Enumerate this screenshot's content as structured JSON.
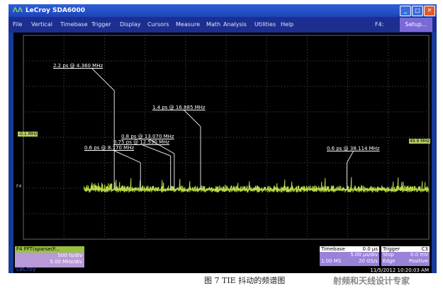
{
  "window": {
    "title": "LeCroy SDA6000",
    "logo": "lecroy-logo-icon",
    "controls": [
      "minimize",
      "maximize",
      "close"
    ]
  },
  "menu": {
    "items": [
      "File",
      "Vertical",
      "Timebase",
      "Trigger",
      "Display",
      "Cursors",
      "Measure",
      "Math",
      "Analysis",
      "Utilities",
      "Help"
    ],
    "shortcut": "F4:",
    "setup": "Setup..."
  },
  "screen": {
    "trace_color": "#b8d848",
    "annotations": [
      {
        "text": "2.2 ps @ 4.360 MHz",
        "freq_mhz": 4.36,
        "ps": 2.2
      },
      {
        "text": "1.4 ps @ 16.885 MHz",
        "freq_mhz": 16.885,
        "ps": 1.4
      },
      {
        "text": "0.8 ps @ 13.070 MHz",
        "freq_mhz": 13.07,
        "ps": 0.8
      },
      {
        "text": "0.75 ps @ 12.530 MHz",
        "freq_mhz": 12.53,
        "ps": 0.75
      },
      {
        "text": "0.6 ps @ 8.170 MHz",
        "freq_mhz": 8.17,
        "ps": 0.6
      },
      {
        "text": "0.6 ps @ 38.114 MHz",
        "freq_mhz": 38.114,
        "ps": 0.6
      }
    ],
    "left_marker": "-0.1 MHz",
    "right_marker": "49.9 MHz",
    "trace_label": "F4"
  },
  "info": {
    "f4": {
      "title": "F4 FFT(sparse(F...",
      "vdiv": "500 fs/div",
      "hdiv": "5.00 MHz/div"
    },
    "brand": "LeCroy",
    "timebase": {
      "label": "Timebase",
      "value": "0.0 µs",
      "div": "5.00 µs/div",
      "samples": "1.00 MS",
      "rate": "20 GS/s"
    },
    "trigger": {
      "label": "Trigger",
      "badge": "C3",
      "mode": "Stop",
      "level": "0.0 mV",
      "type": "Edge",
      "slope": "Positive"
    },
    "datetime": "11/5/2012 10:20:03 AM"
  },
  "caption": "图 7 TIE 抖动的频谱图",
  "watermark": "射频和天线设计专家"
}
